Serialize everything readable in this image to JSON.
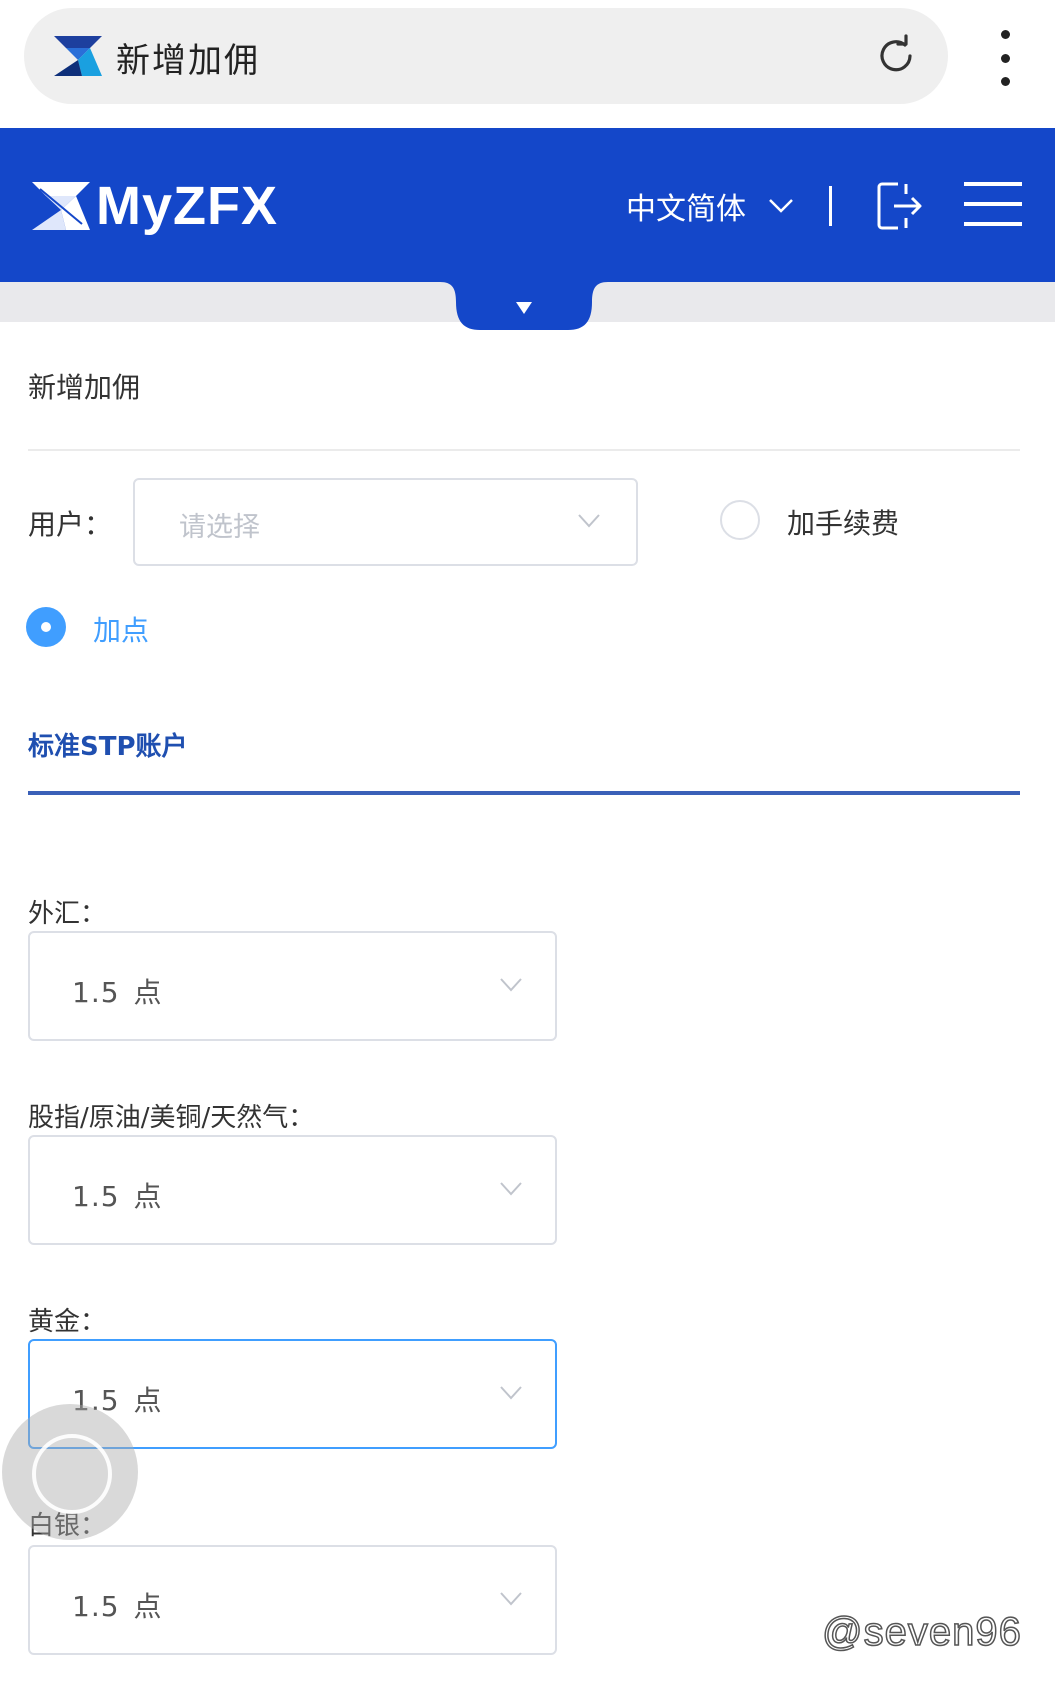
{
  "browser": {
    "tab_title": "新增加佣",
    "reload_icon": "reload-icon",
    "menu_icon": "kebab-menu-icon"
  },
  "header": {
    "brand": "MyZFX",
    "language": "中文简体",
    "background_color": "#1447c9"
  },
  "page": {
    "title": "新增加佣"
  },
  "user_field": {
    "label": "用户：",
    "placeholder": "请选择"
  },
  "mode_options": [
    {
      "label": "加手续费",
      "selected": false
    },
    {
      "label": "加点",
      "selected": true
    }
  ],
  "section": {
    "title": "标准STP账户"
  },
  "fields": [
    {
      "label": "外汇：",
      "value": "1.5",
      "unit": "点",
      "focused": false
    },
    {
      "label": "股指/原油/美铜/天然气：",
      "value": "1.5",
      "unit": "点",
      "focused": false
    },
    {
      "label": "黄金：",
      "value": "1.5",
      "unit": "点",
      "focused": true
    },
    {
      "label": "白银：",
      "value": "1.5",
      "unit": "点",
      "focused": false
    }
  ],
  "watermark": "@seven96",
  "colors": {
    "accent": "#409eff",
    "section_blue": "#1f4fb0"
  }
}
